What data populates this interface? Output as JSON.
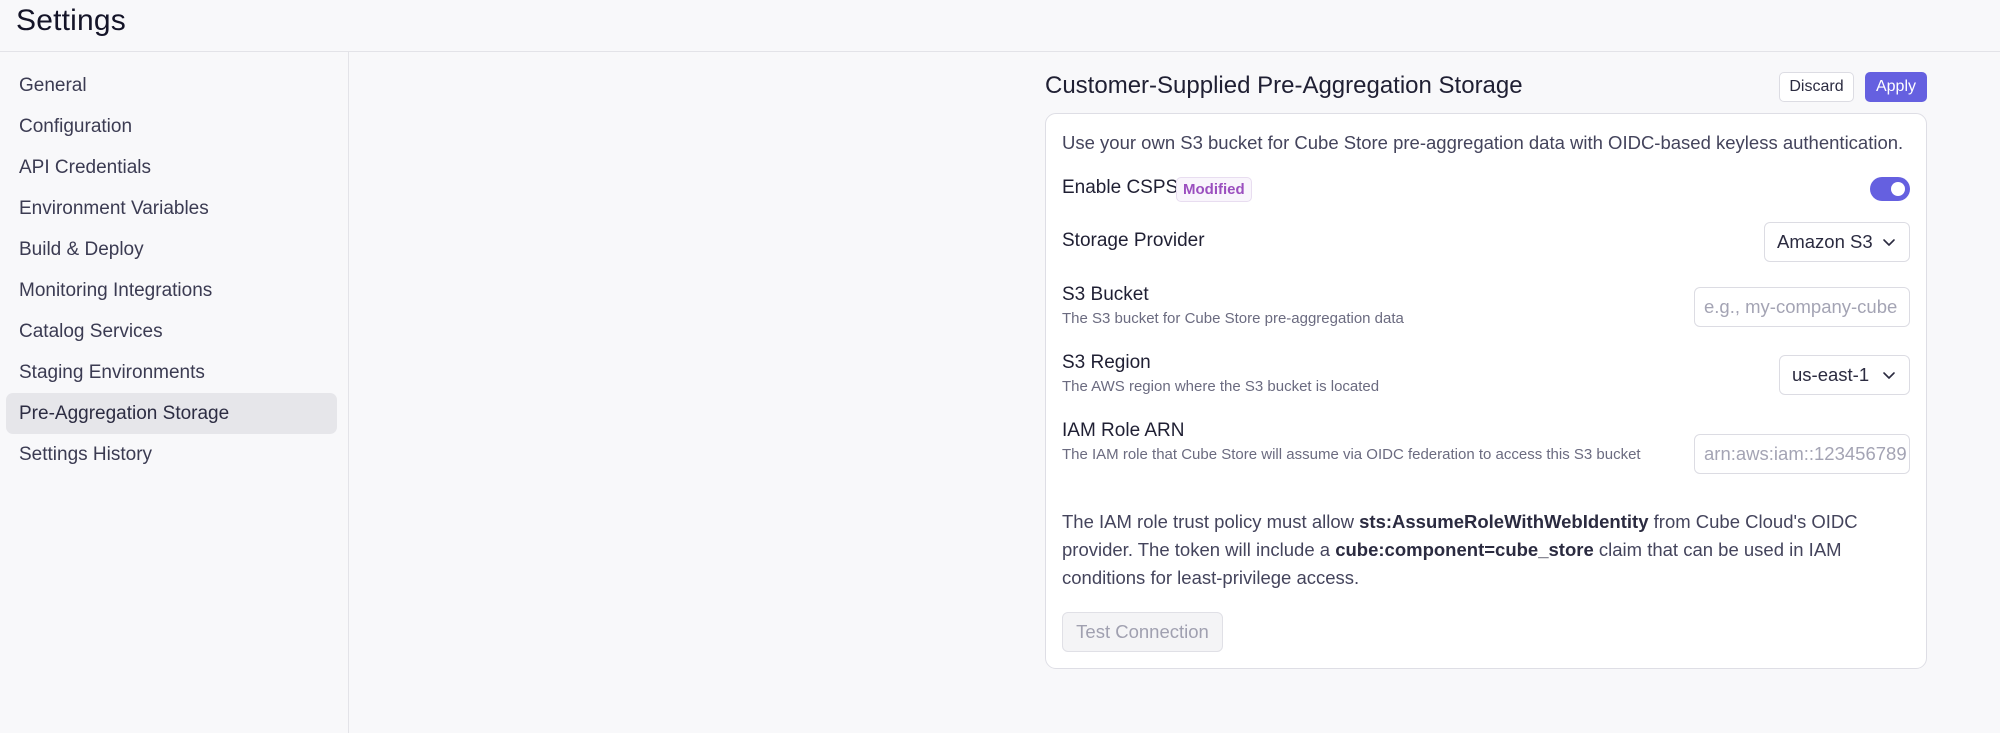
{
  "page": {
    "title": "Settings"
  },
  "sidebar": {
    "items": [
      {
        "label": "General"
      },
      {
        "label": "Configuration"
      },
      {
        "label": "API Credentials"
      },
      {
        "label": "Environment Variables"
      },
      {
        "label": "Build & Deploy"
      },
      {
        "label": "Monitoring Integrations"
      },
      {
        "label": "Catalog Services"
      },
      {
        "label": "Staging Environments"
      },
      {
        "label": "Pre-Aggregation Storage",
        "active": true
      },
      {
        "label": "Settings History"
      }
    ]
  },
  "section": {
    "title": "Customer-Supplied Pre-Aggregation Storage",
    "discard_label": "Discard",
    "apply_label": "Apply",
    "description": "Use your own S3 bucket for Cube Store pre-aggregation data with OIDC-based keyless authentication."
  },
  "form": {
    "enable": {
      "label": "Enable CSPS",
      "badge": "Modified",
      "checked": true
    },
    "provider": {
      "label": "Storage Provider",
      "value": "Amazon S3"
    },
    "bucket": {
      "label": "S3 Bucket",
      "help": "The S3 bucket for Cube Store pre-aggregation data",
      "placeholder": "e.g., my-company-cube"
    },
    "region": {
      "label": "S3 Region",
      "help": "The AWS region where the S3 bucket is located",
      "value": "us-east-1"
    },
    "role": {
      "label": "IAM Role ARN",
      "help": "The IAM role that Cube Store will assume via OIDC federation to access this S3 bucket",
      "placeholder": "arn:aws:iam::123456789"
    },
    "note": {
      "p1": "The IAM role trust policy must allow ",
      "b1": "sts:AssumeRoleWithWebIdentity",
      "p2": " from Cube Cloud's OIDC provider. The token will include a ",
      "b2": "cube:component=cube_store",
      "p3": " claim that can be used in IAM conditions for least-privilege access."
    },
    "test_label": "Test Connection"
  },
  "colors": {
    "accent": "#6560e0",
    "badge_text": "#9b4fbf",
    "sidebar_active_bg": "#e6e6ea"
  },
  "icons": {
    "select_arrow": "chevron-down-icon",
    "toggle_knob": "toggle-knob"
  }
}
